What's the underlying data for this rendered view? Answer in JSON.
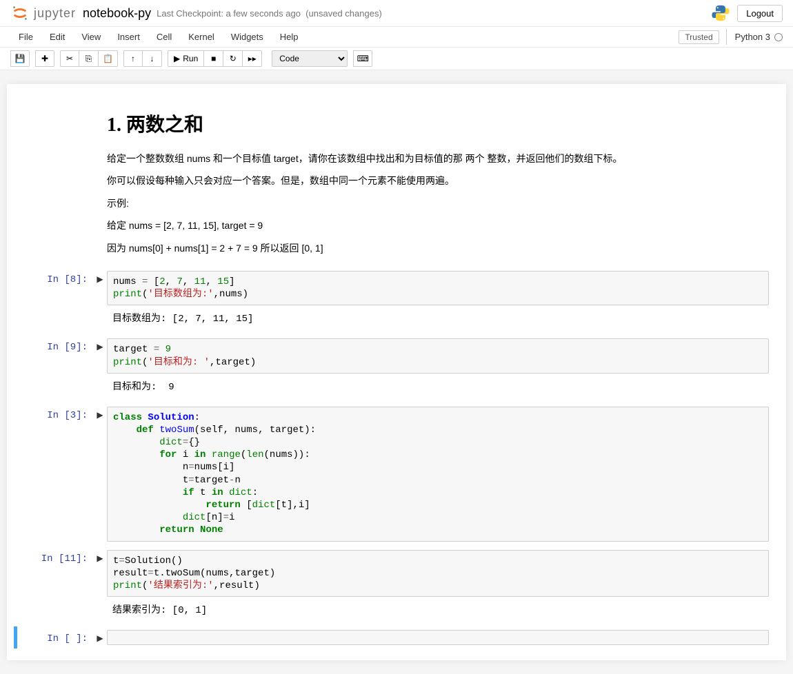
{
  "header": {
    "logo_text": "jupyter",
    "notebook_name": "notebook-py",
    "checkpoint": "Last Checkpoint: a few seconds ago",
    "unsaved": "(unsaved changes)",
    "logout": "Logout"
  },
  "menubar": {
    "items": [
      "File",
      "Edit",
      "View",
      "Insert",
      "Cell",
      "Kernel",
      "Widgets",
      "Help"
    ],
    "trusted": "Trusted",
    "kernel": "Python 3"
  },
  "toolbar": {
    "run_label": "Run",
    "cell_type": "Code"
  },
  "markdown": {
    "title": "1. 两数之和",
    "p1": "给定一个整数数组 nums 和一个目标值 target，请你在该数组中找出和为目标值的那 两个 整数，并返回他们的数组下标。",
    "p2": "你可以假设每种输入只会对应一个答案。但是，数组中同一个元素不能使用两遍。",
    "p3": "示例:",
    "p4": "给定 nums = [2, 7, 11, 15], target = 9",
    "p5": "因为 nums[0] + nums[1] = 2 + 7 = 9 所以返回 [0, 1]"
  },
  "cells": [
    {
      "prompt": "In [8]:",
      "code_plain": "nums = [2, 7, 11, 15]\nprint('目标数组为:',nums)",
      "output": "目标数组为: [2, 7, 11, 15]"
    },
    {
      "prompt": "In [9]:",
      "code_plain": "target = 9\nprint('目标和为: ',target)",
      "output": "目标和为:  9"
    },
    {
      "prompt": "In [3]:",
      "code_plain": "class Solution:\n    def twoSum(self, nums, target):\n        dict={}\n        for i in range(len(nums)):\n            n=nums[i]\n            t=target-n\n            if t in dict:\n                return [dict[t],i]\n            dict[n]=i\n        return None",
      "output": ""
    },
    {
      "prompt": "In [11]:",
      "code_plain": "t=Solution()\nresult=t.twoSum(nums,target)\nprint('结果索引为:',result)",
      "output": "结果索引为: [0, 1]"
    },
    {
      "prompt": "In [ ]:",
      "code_plain": "",
      "output": ""
    }
  ]
}
